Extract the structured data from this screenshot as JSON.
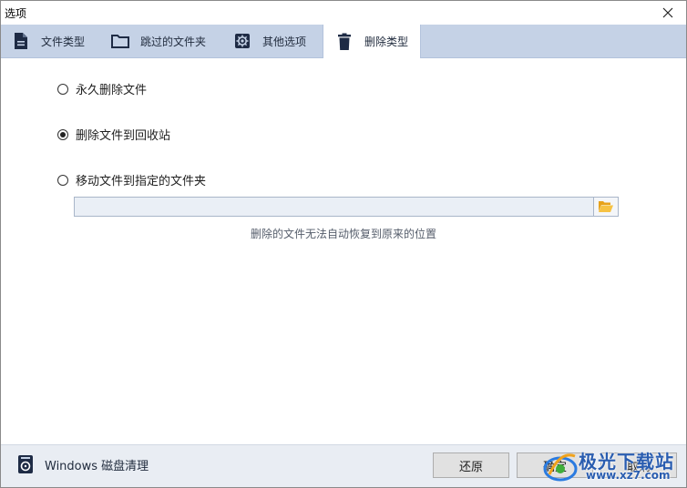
{
  "window": {
    "title": "选项"
  },
  "tabs": [
    {
      "label": "文件类型",
      "icon": "document-icon",
      "active": false
    },
    {
      "label": "跳过的文件夹",
      "icon": "folder-icon",
      "active": false
    },
    {
      "label": "其他选项",
      "icon": "gear-icon",
      "active": false
    },
    {
      "label": "删除类型",
      "icon": "trash-icon",
      "active": true
    }
  ],
  "delete_options": [
    {
      "label": "永久删除文件",
      "selected": false
    },
    {
      "label": "删除文件到回收站",
      "selected": true
    },
    {
      "label": "移动文件到指定的文件夹",
      "selected": false
    }
  ],
  "folder_field": {
    "value": ""
  },
  "hint": "删除的文件无法自动恢复到原来的位置",
  "footer": {
    "disk_cleanup_label": "Windows 磁盘清理",
    "restore_label": "还原",
    "ok_label": "确定",
    "cancel_label": "取消"
  },
  "watermark": {
    "brand": "极光下载站",
    "url": "www.xz7.com"
  },
  "colors": {
    "tab_strip": "#c5d2e6",
    "footer_bg": "#e9edf3",
    "icon_dark": "#1e2b45",
    "folder_icon": "#e7a21b"
  }
}
